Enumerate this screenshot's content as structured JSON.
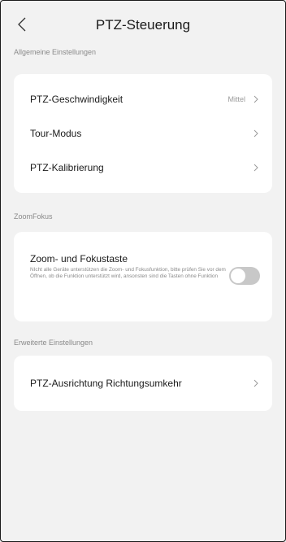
{
  "header": {
    "title": "PTZ-Steuerung",
    "back_icon": "chevron-left-icon"
  },
  "sections": {
    "general": {
      "label": "Allgemeine Einstellungen",
      "items": [
        {
          "label": "PTZ-Geschwindigkeit",
          "value": "Mittel"
        },
        {
          "label": "Tour-Modus",
          "value": ""
        },
        {
          "label": "PTZ-Kalibrierung",
          "value": ""
        }
      ]
    },
    "zoom": {
      "label": "ZoomFokus",
      "title": "Zoom- und Fokustaste",
      "description": "NIcht alle Geräte unterstützen die Zoom- und Fokusfunktion, bitte prüfen Sie vor dem Öffnen, ob die Funktion unterstützt wird, ansonsten sind die Tasten ohne Funktion",
      "toggle_on": false
    },
    "advanced": {
      "label": "Erweiterte Einstellungen",
      "items": [
        {
          "label": "PTZ-Ausrichtung Richtungsumkehr"
        }
      ]
    }
  },
  "colors": {
    "background": "#f2f2f2",
    "card": "#ffffff",
    "toggle_off": "#c8c8c8"
  }
}
